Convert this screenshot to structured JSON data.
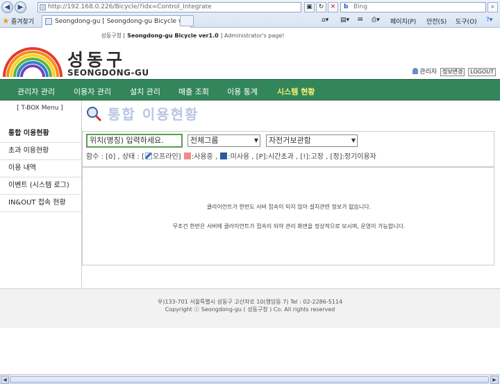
{
  "browser": {
    "url": "http://192.168.0.226/Bicycle/?idx=Control_Integrate",
    "search_placeholder": "Bing",
    "favorites_label": "즐겨찾기",
    "tab_title": "Seongdong-gu [ Seongdong-gu Bicycle ver1...",
    "commands": [
      "페이지(P)",
      "안전(S)",
      "도구(O)"
    ]
  },
  "header": {
    "system_prefix": "성동구청 [",
    "system_name": "Seongdong-gu Bicycle ver1.0",
    "system_suffix": "] Administrator's page!",
    "logo_kr": "성동구",
    "logo_en": "SEONGDONG-GU",
    "admin_label": "관리자",
    "change_info_button": "정보변경",
    "logout_button": "LOGOUT"
  },
  "menu": [
    {
      "label": "관리자 관리",
      "active": false
    },
    {
      "label": "이용자 관리",
      "active": false
    },
    {
      "label": "설치 관리",
      "active": false
    },
    {
      "label": "매출 조회",
      "active": false
    },
    {
      "label": "이용 통계",
      "active": false
    },
    {
      "label": "시스템 현황",
      "active": true
    }
  ],
  "sidebar": {
    "title": "[ T-BOX Menu ]",
    "items": [
      {
        "label": "통합 이용현황",
        "active": true
      },
      {
        "label": "초과 이용현황",
        "active": false
      },
      {
        "label": "이용 내역",
        "active": false
      },
      {
        "label": "이벤트 (시스템 로그)",
        "active": false
      },
      {
        "label": "IN&OUT 접속 현황",
        "active": false
      }
    ]
  },
  "content": {
    "title": "통합 이용현황",
    "place_input_value": "위치(명칭) 입력하세요.",
    "group_select": "전체그룹",
    "bike_select": "자전거보관함",
    "legend": {
      "count_text": "함수 : [0] , 상태 : [",
      "offline": "오프라인]",
      "in_use": ":사용중 ,",
      "unused": ":미사용 ,",
      "timeout": "[P]:시간초과 ,",
      "fault": "[!]:고장 ,",
      "regular": "[정]:정기이용자"
    },
    "message_line1": "클라이언트가 한번도 서버 접속이 되지 않아 설치관련 정보가 없습니다.",
    "message_line2": "무조건 한번은 서버에 클라이언트가 접속이 되야 관리 화면을 정상적으로 보시며, 운영이 가능합니다."
  },
  "footer": {
    "address": "우)133-701 서울특별시 성동구 고산자로 10(행당동 7) Tel : 02-2286-5114",
    "copyright": "Copyright ⓒ Seongdong-gu ( 성동구청 ) Co. All rights reserved"
  },
  "colors": {
    "menu_bar": "#33865a",
    "menu_active": "#f8f271",
    "input_border": "#55a04a",
    "title_text": "#b7c6e2"
  }
}
